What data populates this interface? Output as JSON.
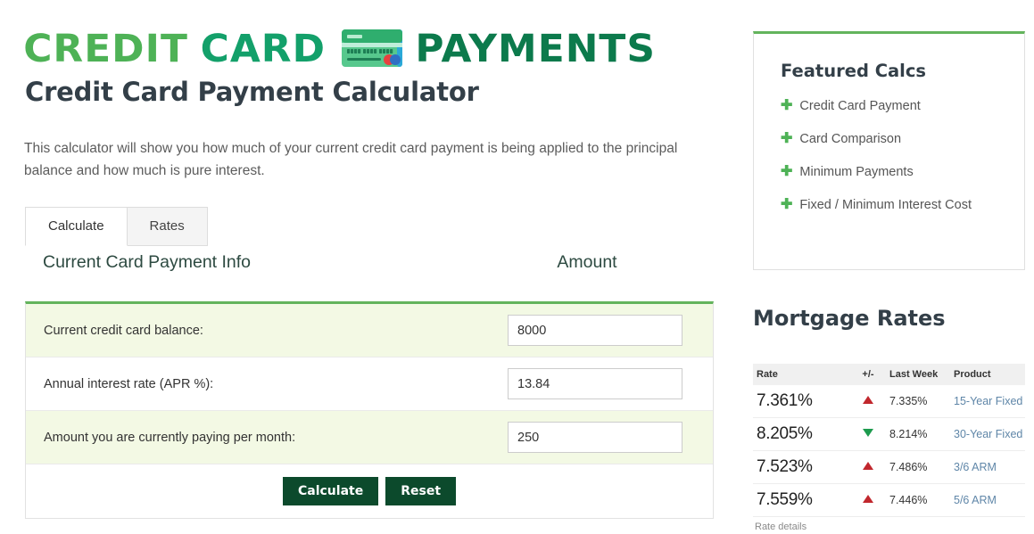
{
  "logo": {
    "word1": "CREDIT",
    "word2": "CARD",
    "word3": "PAYMENTS",
    "card_icon": "credit-card-icon",
    "color1": "#4eb256",
    "color2": "#13a06a",
    "color3": "#0c7a4c"
  },
  "page_title": "Credit Card Payment Calculator",
  "intro": "This calculator will show you how much of your current credit card payment is being applied to the principal balance and how much is pure interest.",
  "tabs": [
    {
      "label": "Calculate",
      "active": true
    },
    {
      "label": "Rates",
      "active": false
    }
  ],
  "section": {
    "info_header": "Current Card Payment Info",
    "amount_header": "Amount"
  },
  "form": {
    "rows": [
      {
        "label": "Current credit card balance:",
        "value": "8000",
        "placeholder": ""
      },
      {
        "label": "Annual interest rate (APR %):",
        "value": "13.84",
        "placeholder": ""
      },
      {
        "label": "Amount you are currently paying per month:",
        "value": "250",
        "placeholder": ""
      }
    ],
    "calculate_label": "Calculate",
    "reset_label": "Reset",
    "button_color": "#0c4a2c",
    "accent_color": "#63b45c"
  },
  "sidebar": {
    "featured": {
      "title": "Featured Calcs",
      "items": [
        {
          "icon": "plus-icon",
          "label": "Credit Card Payment"
        },
        {
          "icon": "plus-icon",
          "label": "Card Comparison"
        },
        {
          "icon": "plus-icon",
          "label": "Minimum Payments"
        },
        {
          "icon": "plus-icon",
          "label": "Fixed / Minimum Interest Cost"
        }
      ]
    },
    "mortgage": {
      "title": "Mortgage Rates",
      "columns": [
        "Rate",
        "+/-",
        "Last Week",
        "Product"
      ],
      "rows": [
        {
          "rate": "7.361%",
          "direction": "up",
          "last_week": "7.335%",
          "product": "15-Year Fixed"
        },
        {
          "rate": "8.205%",
          "direction": "down",
          "last_week": "8.214%",
          "product": "30-Year Fixed"
        },
        {
          "rate": "7.523%",
          "direction": "up",
          "last_week": "7.486%",
          "product": "3/6 ARM"
        },
        {
          "rate": "7.559%",
          "direction": "up",
          "last_week": "7.446%",
          "product": "5/6 ARM"
        }
      ],
      "details_link": "Rate details",
      "up_color": "#c1272d",
      "down_color": "#1d9b4e"
    }
  }
}
